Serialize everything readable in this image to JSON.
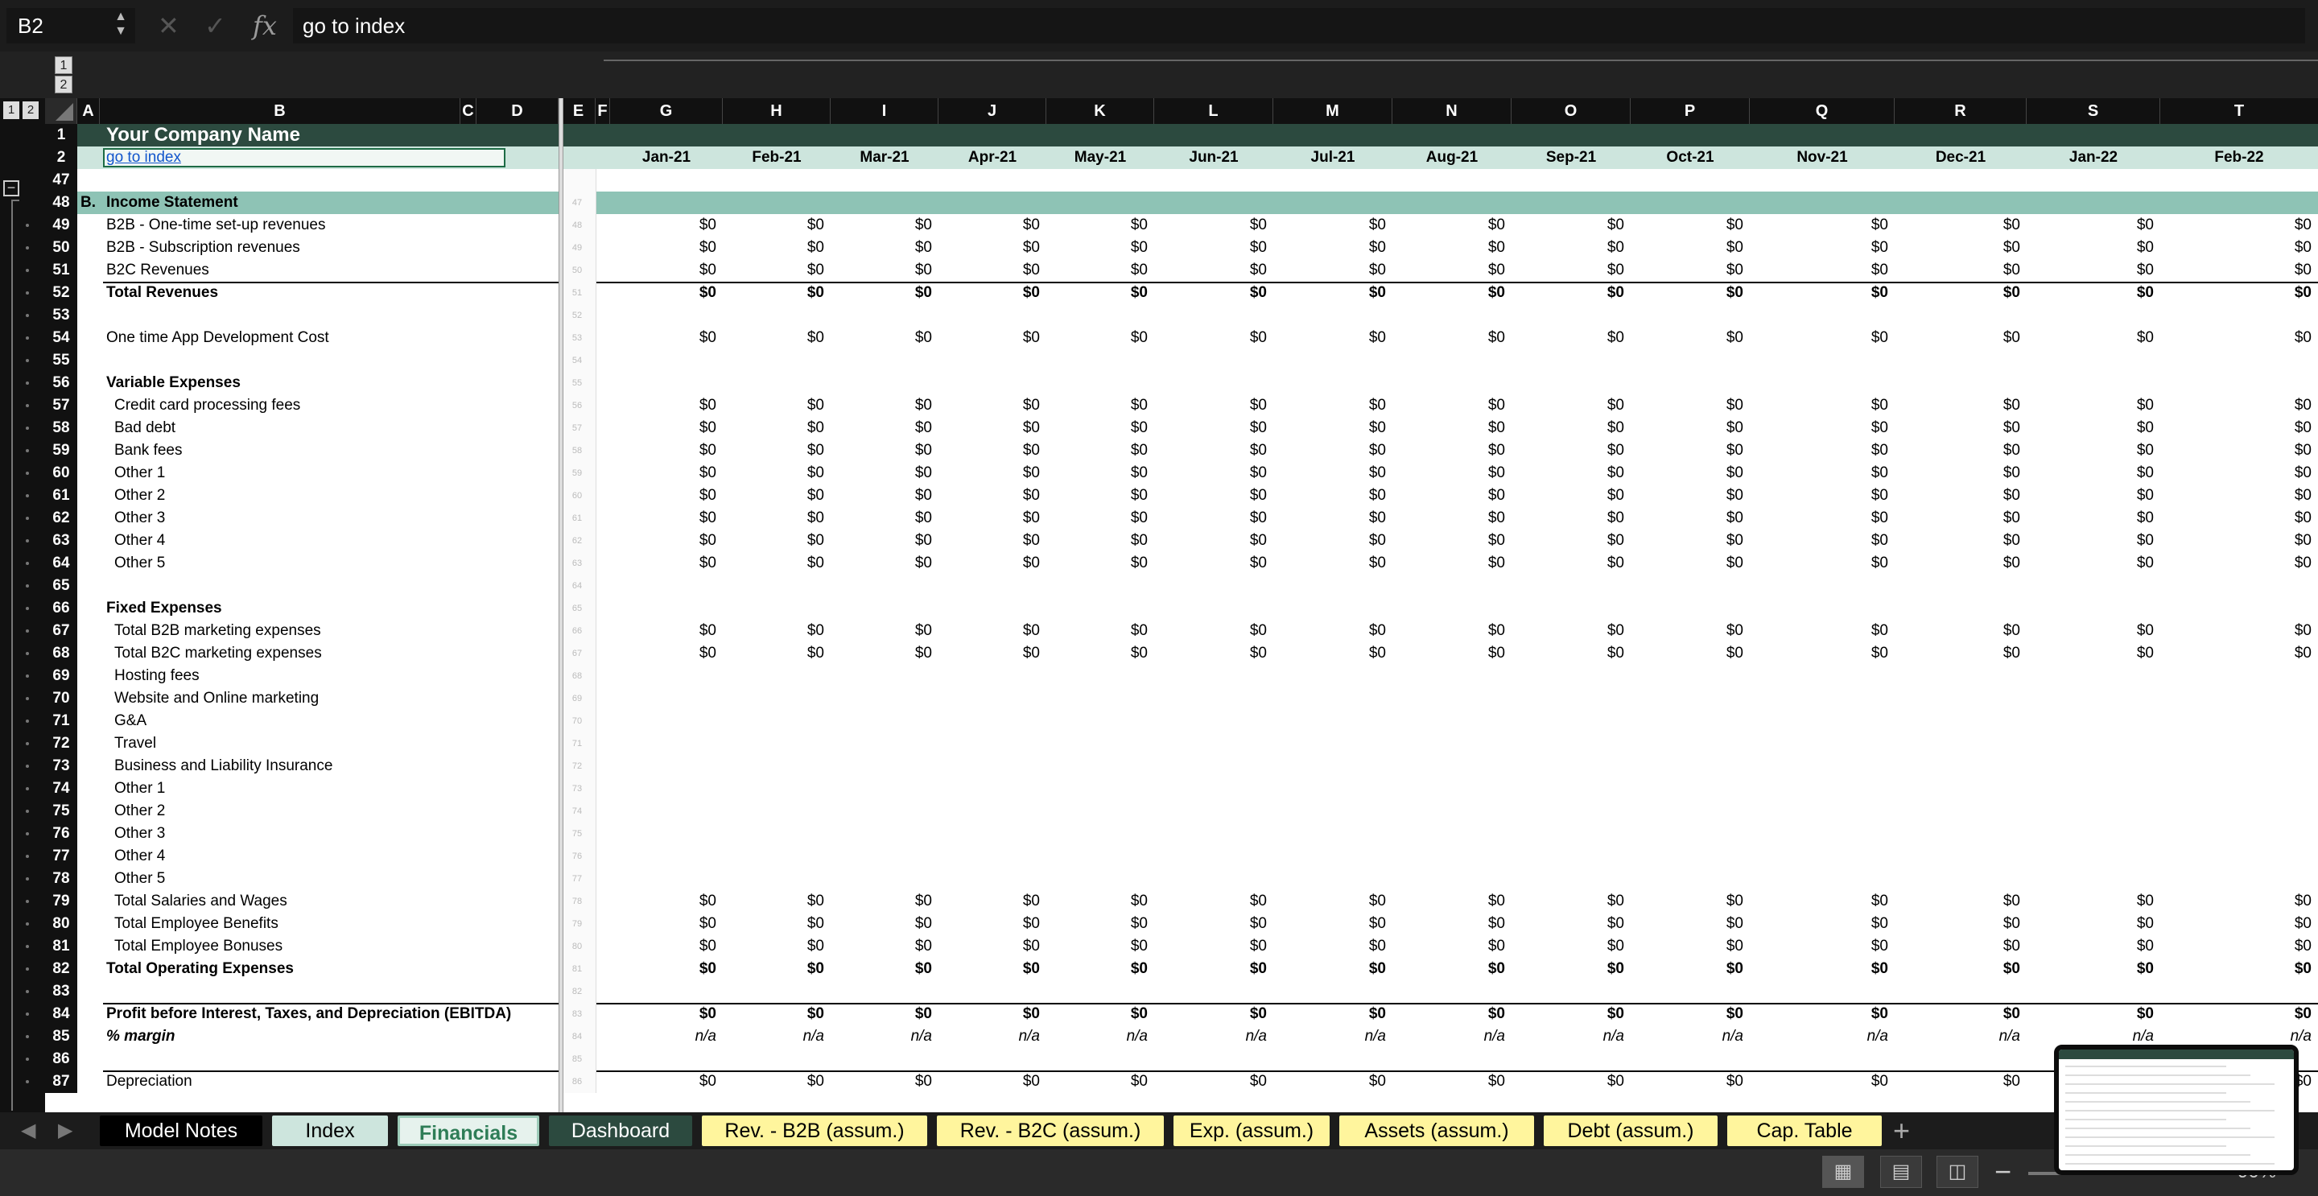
{
  "formula_bar": {
    "cell_ref": "B2",
    "stepper_glyph": "▲▼",
    "cancel_glyph": "✕",
    "confirm_glyph": "✓",
    "fx_label": "fx",
    "content": "go to index"
  },
  "outline": {
    "levels": [
      "1",
      "2"
    ],
    "collapse_glyph": "−"
  },
  "columns": [
    "A",
    "B",
    "C",
    "D",
    "E",
    "F",
    "G",
    "H",
    "I",
    "J",
    "K",
    "L",
    "M",
    "N",
    "O",
    "P",
    "Q",
    "R",
    "S",
    "T"
  ],
  "sheet": {
    "company_name": "Your Company Name",
    "go_to_index": "go to index",
    "months": [
      "Jan-21",
      "Feb-21",
      "Mar-21",
      "Apr-21",
      "May-21",
      "Jun-21",
      "Jul-21",
      "Aug-21",
      "Sep-21",
      "Oct-21",
      "Nov-21",
      "Dec-21",
      "Jan-22",
      "Feb-22"
    ],
    "section_letter": "B.",
    "section_title": "Income Statement"
  },
  "rows": [
    {
      "num": "47",
      "label": "",
      "style": "",
      "values": "",
      "e": ""
    },
    {
      "num": "48",
      "label": "Income Statement",
      "style": "section",
      "values": "",
      "e": "47"
    },
    {
      "num": "49",
      "label": "B2B - One-time set-up revenues",
      "style": "",
      "values": "$0",
      "e": "48"
    },
    {
      "num": "50",
      "label": "B2B - Subscription revenues",
      "style": "",
      "values": "$0",
      "e": "49"
    },
    {
      "num": "51",
      "label": "B2C Revenues",
      "style": "",
      "values": "$0",
      "e": "50"
    },
    {
      "num": "52",
      "label": "Total Revenues",
      "style": "bold",
      "values": "$0",
      "e": "51",
      "border": true
    },
    {
      "num": "53",
      "label": "",
      "style": "",
      "values": "",
      "e": "52"
    },
    {
      "num": "54",
      "label": "One time App Development Cost",
      "style": "",
      "values": "$0",
      "e": "53"
    },
    {
      "num": "55",
      "label": "",
      "style": "",
      "values": "",
      "e": "54"
    },
    {
      "num": "56",
      "label": "Variable Expenses",
      "style": "bold",
      "values": "",
      "e": "55"
    },
    {
      "num": "57",
      "label": "Credit card processing fees",
      "style": "indent",
      "values": "$0",
      "e": "56"
    },
    {
      "num": "58",
      "label": "Bad debt",
      "style": "indent",
      "values": "$0",
      "e": "57"
    },
    {
      "num": "59",
      "label": "Bank fees",
      "style": "indent",
      "values": "$0",
      "e": "58"
    },
    {
      "num": "60",
      "label": "Other 1",
      "style": "indent",
      "values": "$0",
      "e": "59"
    },
    {
      "num": "61",
      "label": "Other 2",
      "style": "indent",
      "values": "$0",
      "e": "60"
    },
    {
      "num": "62",
      "label": "Other 3",
      "style": "indent",
      "values": "$0",
      "e": "61"
    },
    {
      "num": "63",
      "label": "Other 4",
      "style": "indent",
      "values": "$0",
      "e": "62"
    },
    {
      "num": "64",
      "label": "Other 5",
      "style": "indent",
      "values": "$0",
      "e": "63"
    },
    {
      "num": "65",
      "label": "",
      "style": "",
      "values": "",
      "e": "64"
    },
    {
      "num": "66",
      "label": "Fixed Expenses",
      "style": "bold",
      "values": "",
      "e": "65"
    },
    {
      "num": "67",
      "label": "Total B2B marketing expenses",
      "style": "indent",
      "values": "$0",
      "e": "66"
    },
    {
      "num": "68",
      "label": "Total B2C marketing expenses",
      "style": "indent",
      "values": "$0",
      "e": "67"
    },
    {
      "num": "69",
      "label": "Hosting fees",
      "style": "indent",
      "values": "",
      "e": "68"
    },
    {
      "num": "70",
      "label": "Website and Online marketing",
      "style": "indent",
      "values": "",
      "e": "69"
    },
    {
      "num": "71",
      "label": "G&A",
      "style": "indent",
      "values": "",
      "e": "70"
    },
    {
      "num": "72",
      "label": "Travel",
      "style": "indent",
      "values": "",
      "e": "71"
    },
    {
      "num": "73",
      "label": "Business and Liability Insurance",
      "style": "indent",
      "values": "",
      "e": "72"
    },
    {
      "num": "74",
      "label": "Other 1",
      "style": "indent",
      "values": "",
      "e": "73"
    },
    {
      "num": "75",
      "label": "Other 2",
      "style": "indent",
      "values": "",
      "e": "74"
    },
    {
      "num": "76",
      "label": "Other 3",
      "style": "indent",
      "values": "",
      "e": "75"
    },
    {
      "num": "77",
      "label": "Other 4",
      "style": "indent",
      "values": "",
      "e": "76"
    },
    {
      "num": "78",
      "label": "Other 5",
      "style": "indent",
      "values": "",
      "e": "77"
    },
    {
      "num": "79",
      "label": "Total Salaries and Wages",
      "style": "indent",
      "values": "$0",
      "e": "78"
    },
    {
      "num": "80",
      "label": "Total Employee Benefits",
      "style": "indent",
      "values": "$0",
      "e": "79"
    },
    {
      "num": "81",
      "label": "Total Employee Bonuses",
      "style": "indent",
      "values": "$0",
      "e": "80"
    },
    {
      "num": "82",
      "label": "Total Operating Expenses",
      "style": "bold",
      "values": "$0",
      "e": "81"
    },
    {
      "num": "83",
      "label": "",
      "style": "",
      "values": "",
      "e": "82"
    },
    {
      "num": "84",
      "label": "Profit before Interest, Taxes, and Depreciation (EBITDA)",
      "style": "bold",
      "values": "$0",
      "e": "83",
      "border": true
    },
    {
      "num": "85",
      "label": "% margin",
      "style": "italic",
      "values": "n/a",
      "e": "84"
    },
    {
      "num": "86",
      "label": "",
      "style": "",
      "values": "",
      "e": "85"
    },
    {
      "num": "87",
      "label": "Depreciation",
      "style": "",
      "values": "$0",
      "e": "86",
      "border": true
    }
  ],
  "tabs": [
    {
      "label": "Model Notes",
      "bg": "#000000",
      "fg": "#ffffff"
    },
    {
      "label": "Index",
      "bg": "#cde5dd",
      "fg": "#000000"
    },
    {
      "label": "Financials",
      "bg": "#e6f2ed",
      "fg": "#2e7d57",
      "active": true
    },
    {
      "label": "Dashboard",
      "bg": "#2c4a3f",
      "fg": "#ffffff"
    },
    {
      "label": "Rev. - B2B (assum.)",
      "bg": "#fff59d",
      "fg": "#000000"
    },
    {
      "label": "Rev. - B2C (assum.)",
      "bg": "#fff59d",
      "fg": "#000000"
    },
    {
      "label": "Exp. (assum.)",
      "bg": "#fff59d",
      "fg": "#000000"
    },
    {
      "label": "Assets (assum.)",
      "bg": "#fff59d",
      "fg": "#000000"
    },
    {
      "label": "Debt (assum.)",
      "bg": "#fff59d",
      "fg": "#000000"
    },
    {
      "label": "Cap. Table",
      "bg": "#fff59d",
      "fg": "#000000"
    }
  ],
  "tab_nav": {
    "prev": "◀",
    "next": "▶",
    "add": "+"
  },
  "status": {
    "view_normal_glyph": "▦",
    "view_layout_glyph": "▤",
    "view_break_glyph": "◫",
    "zoom_minus": "−",
    "zoom_level": "90%"
  },
  "colors": {
    "header_band": "#2c4a3f",
    "month_band": "#cde5dd",
    "section_band": "#8ec3b5",
    "assumption_tab": "#fff59d",
    "link": "#1155cc"
  }
}
